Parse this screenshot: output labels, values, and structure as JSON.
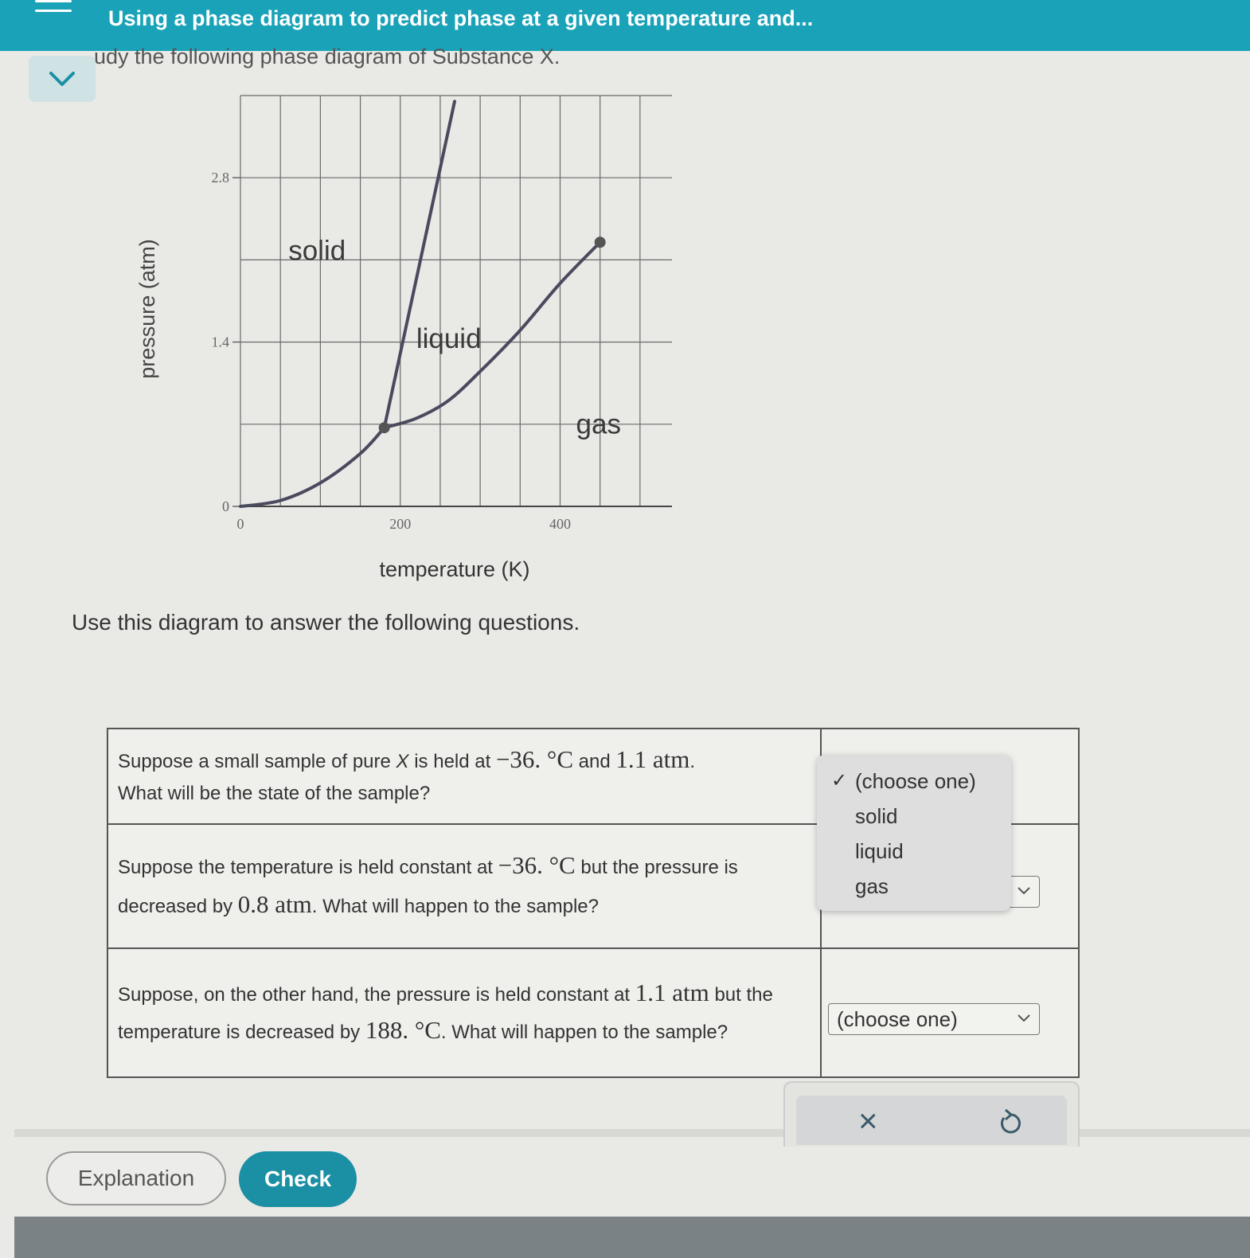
{
  "header": {
    "title": "Using a phase diagram to predict phase at a given temperature and..."
  },
  "intro_text": "udy the following phase diagram of Substance X.",
  "chart_data": {
    "type": "line",
    "xlabel": "temperature (K)",
    "ylabel": "pressure (atm)",
    "xlim": [
      0,
      540
    ],
    "ylim": [
      0,
      3.5
    ],
    "x_ticks": [
      0,
      200,
      400
    ],
    "y_ticks": [
      0,
      1.4,
      2.8
    ],
    "grid": true,
    "region_labels": [
      "solid",
      "liquid",
      "gas"
    ],
    "series": [
      {
        "x": [
          0,
          50,
          100,
          150,
          180
        ],
        "y": [
          0,
          0.05,
          0.2,
          0.45,
          0.67
        ]
      },
      {
        "x": [
          180,
          268
        ],
        "y": [
          0.67,
          3.45
        ]
      },
      {
        "x": [
          180,
          220,
          260,
          300,
          350,
          400,
          450
        ],
        "y": [
          0.67,
          0.75,
          0.9,
          1.15,
          1.5,
          1.9,
          2.25
        ]
      }
    ],
    "points": [
      {
        "x": 180,
        "y": 0.67
      },
      {
        "x": 450,
        "y": 2.25
      }
    ]
  },
  "instructions": "Use this diagram to answer the following questions.",
  "questions": [
    {
      "t1": "Suppose a small sample of pure ",
      "var": "X",
      "t2": " is held at ",
      "m1": "−36. °C",
      "t3": " and ",
      "m2": "1.1 atm",
      "t4": ".",
      "t5": "What will be the state of the sample?"
    },
    {
      "t1": "Suppose the temperature is held constant at ",
      "m1": "−36. °C",
      "t2": " but the pressure is decreased by ",
      "m2": "0.8 atm",
      "t3": ". What will happen to the sample?"
    },
    {
      "t1": "Suppose, on the other hand, the pressure is held constant at ",
      "m1": "1.1 atm",
      "t2": " but the temperature is decreased by ",
      "m2": "188. °C",
      "t3": ". What will happen to the sample?"
    }
  ],
  "dropdown_menu": {
    "check_mark": "✓",
    "options": [
      "(choose one)",
      "solid",
      "liquid",
      "gas"
    ]
  },
  "dropdown3": {
    "selected": "(choose one)"
  },
  "tools": {
    "clear_symbol": "×"
  },
  "buttons": {
    "explanation": "Explanation",
    "check": "Check"
  },
  "colors": {
    "header_bg": "#1aa3b8",
    "check_button": "#1b8fa3",
    "curve": "#4a4a5e"
  }
}
